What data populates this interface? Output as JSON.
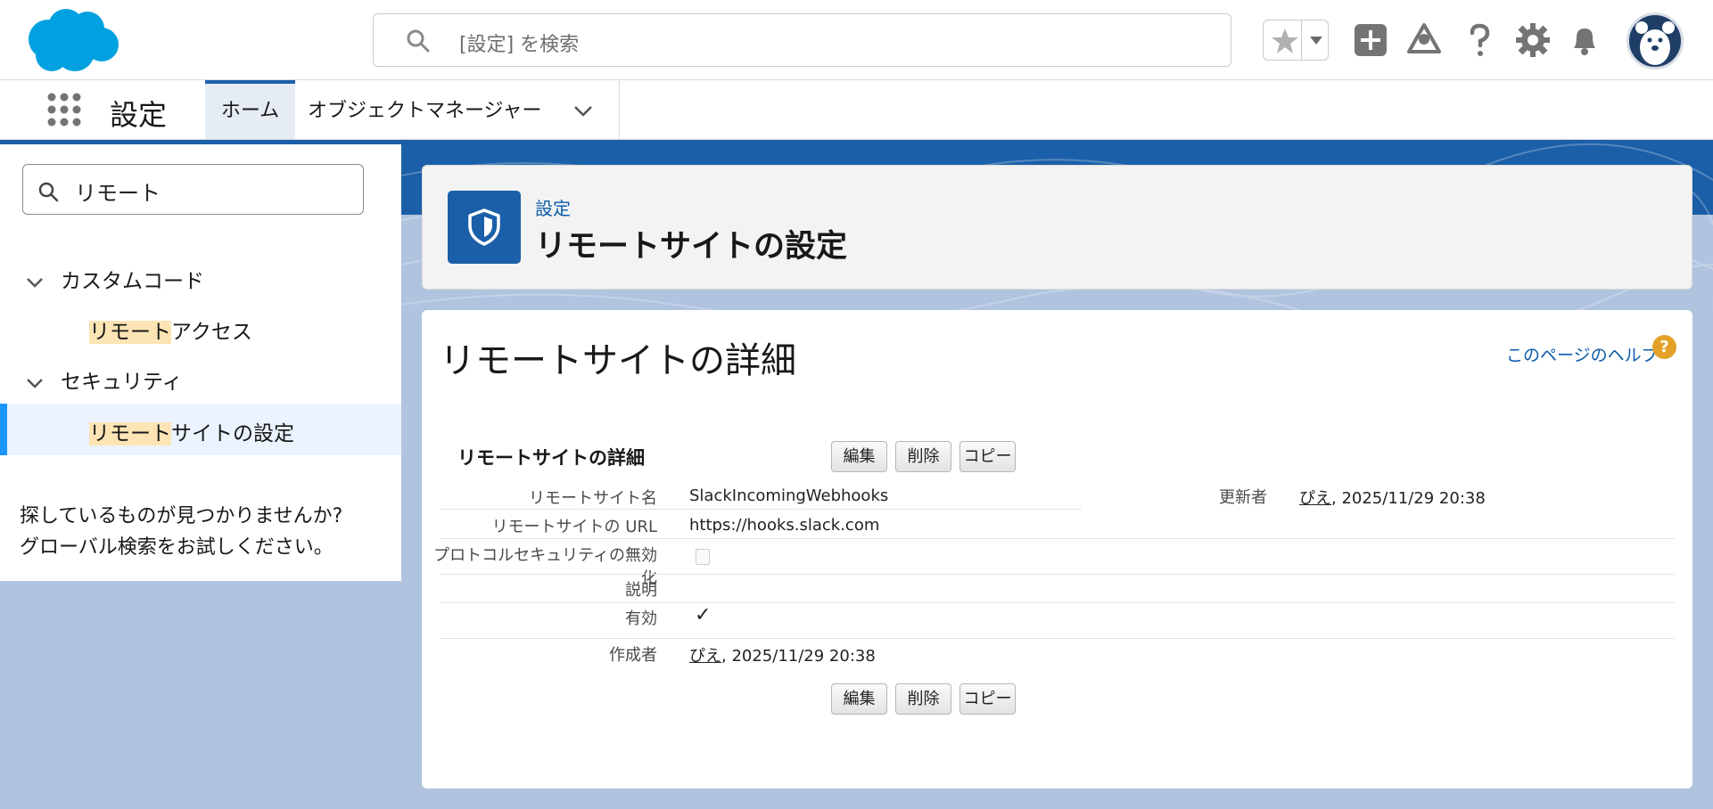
{
  "header": {
    "search_placeholder": "[設定] を検索"
  },
  "nav": {
    "app_name": "設定",
    "tabs": [
      {
        "label": "ホーム"
      },
      {
        "label": "オブジェクトマネージャー"
      }
    ]
  },
  "sidebar": {
    "quickfind_value": "リモート",
    "highlight": "リモート",
    "groups": [
      {
        "label": "カスタムコード",
        "items": [
          {
            "rest": "アクセス"
          }
        ]
      },
      {
        "label": "セキュリティ",
        "items": [
          {
            "rest": "サイトの設定"
          }
        ]
      }
    ],
    "not_found_line1": "探しているものが見つかりませんか?",
    "not_found_line2": "グローバル検索をお試しください。"
  },
  "page_header": {
    "breadcrumb": "設定",
    "title": "リモートサイトの設定"
  },
  "detail": {
    "title": "リモートサイトの詳細",
    "help_link": "このページのヘルプ",
    "help_icon": "?",
    "section_title": "リモートサイトの詳細",
    "buttons": {
      "edit": "編集",
      "delete": "削除",
      "copy": "コピー"
    },
    "fields": {
      "name_label": "リモートサイト名",
      "name_value": "SlackIncomingWebhooks",
      "url_label": "リモートサイトの URL",
      "url_value": "https://hooks.slack.com",
      "protocol_label": "プロトコルセキュリティの無効化",
      "protocol_checked": false,
      "desc_label": "説明",
      "active_label": "有効",
      "active_checked": true,
      "active_mark": "✓",
      "created_label": "作成者",
      "created_user": "ぴえ",
      "created_date": ", 2025/11/29 20:38",
      "modified_label": "更新者",
      "modified_user": "ぴえ",
      "modified_date": ", 2025/11/29 20:38"
    }
  },
  "colors": {
    "brand": "#1b5fa8",
    "link": "#0b5cab",
    "highlight": "#fce4b4",
    "page_bg": "#b0c4df"
  },
  "icons": [
    "salesforce-cloud-logo",
    "search-icon",
    "star-icon",
    "add-icon",
    "trailhead-icon",
    "help-icon",
    "setup-gear-icon",
    "bell-icon",
    "app-launcher-icon",
    "shield-icon"
  ]
}
